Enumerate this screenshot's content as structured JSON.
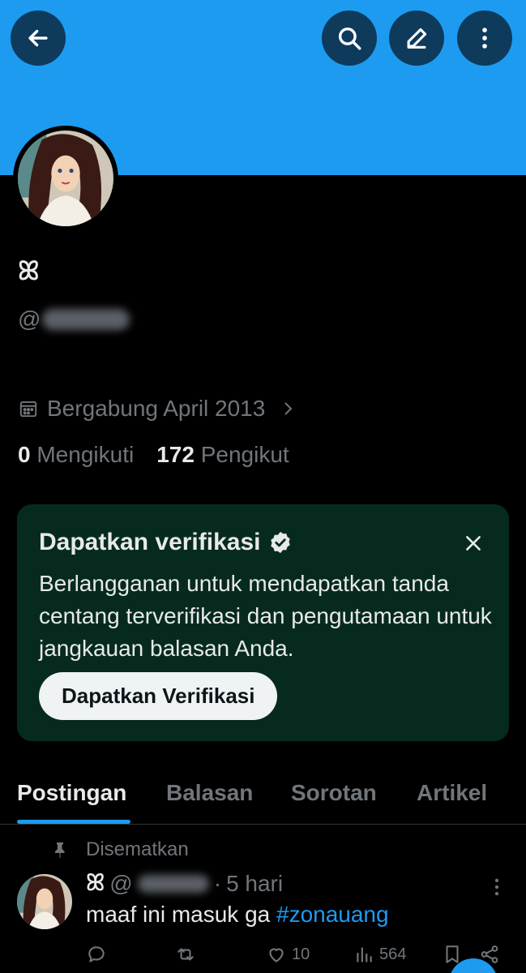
{
  "header": {
    "back_icon": "arrow-left-icon",
    "search_icon": "search-icon",
    "edit_icon": "pencil-icon",
    "more_icon": "more-vertical-icon",
    "banner_color": "#1d9bf0"
  },
  "profile": {
    "display_name": "ꕤ",
    "handle_prefix": "@",
    "joined": "Bergabung April 2013",
    "following_count": "0",
    "following_label": "Mengikuti",
    "followers_count": "172",
    "followers_label": "Pengikut"
  },
  "promo": {
    "title": "Dapatkan verifikasi",
    "body": "Berlangganan untuk mendapatkan tanda centang terverifikasi dan pengutamaan untuk jangkauan balasan Anda.",
    "button": "Dapatkan Verifikasi",
    "background": "#072a1f"
  },
  "tabs": [
    {
      "label": "Postingan",
      "active": true
    },
    {
      "label": "Balasan",
      "active": false
    },
    {
      "label": "Sorotan",
      "active": false
    },
    {
      "label": "Artikel",
      "active": false
    }
  ],
  "post": {
    "pinned_label": "Disematkan",
    "author_name": "ꕤ",
    "handle_prefix": "@",
    "time": "5 hari",
    "text_before": "maaf ini masuk ga ",
    "hashtag": "#zonauang",
    "likes": "10",
    "views": "564"
  },
  "colors": {
    "accent": "#1d9bf0",
    "muted": "#71767b",
    "text": "#e7e9ea"
  }
}
